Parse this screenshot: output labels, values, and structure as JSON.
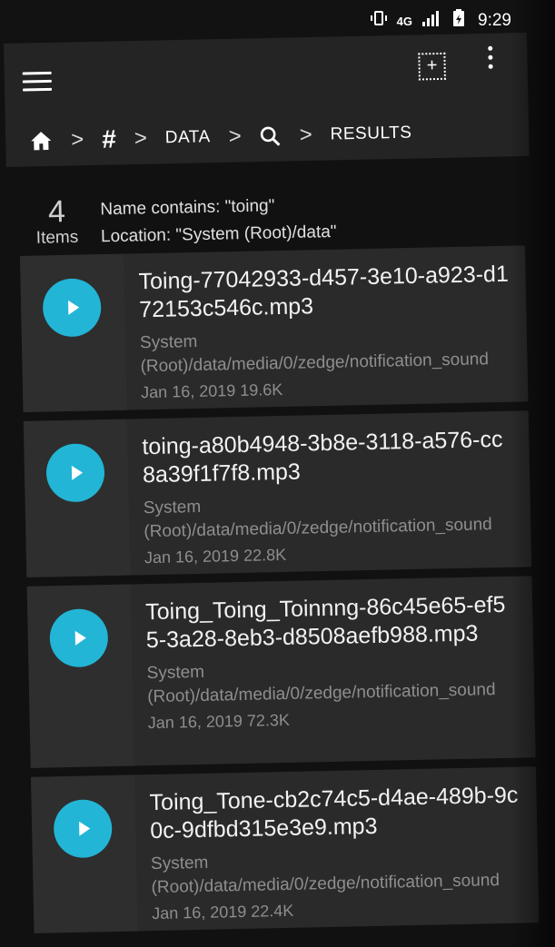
{
  "status_bar": {
    "network": "4G",
    "time": "9:29",
    "icons": [
      "vibrate-icon",
      "lte-icon",
      "signal-icon",
      "battery-charging-icon"
    ]
  },
  "toolbar": {
    "menu_icon": "hamburger-menu-icon",
    "select_icon": "select-add-icon",
    "overflow_icon": "more-vert-icon"
  },
  "breadcrumb": {
    "home_icon": "home-icon",
    "root_label": "#",
    "data_label": "DATA",
    "search_icon": "search-icon",
    "results_label": "RESULTS",
    "separator": ">"
  },
  "summary": {
    "count": "4",
    "count_label": "Items",
    "name_filter": "Name contains: \"toing\"",
    "location_filter": "Location: \"System (Root)/data\""
  },
  "results": [
    {
      "name": "Toing-77042933-d457-3e10-a923-d172153c546c.mp3",
      "path": "System (Root)/data/media/0/zedge/notification_sound",
      "date": "Jan 16, 2019",
      "size": "19.6K"
    },
    {
      "name": "toing-a80b4948-3b8e-3118-a576-cc8a39f1f7f8.mp3",
      "path": "System (Root)/data/media/0/zedge/notification_sound",
      "date": "Jan 16, 2019",
      "size": "22.8K"
    },
    {
      "name": "Toing_Toing_Toinnng-86c45e65-ef55-3a28-8eb3-d8508aefb988.mp3",
      "path": "System (Root)/data/media/0/zedge/notification_sound",
      "date": "Jan 16, 2019",
      "size": "72.3K"
    },
    {
      "name": "Toing_Tone-cb2c74c5-d4ae-489b-9c0c-9dfbd315e3e9.mp3",
      "path": "System (Root)/data/media/0/zedge/notification_sound",
      "date": "Jan 16, 2019",
      "size": "22.4K"
    }
  ],
  "colors": {
    "accent": "#22b5d6",
    "toolbar_bg": "#242424",
    "card_bg": "#2a2a2a",
    "background": "#111111"
  }
}
